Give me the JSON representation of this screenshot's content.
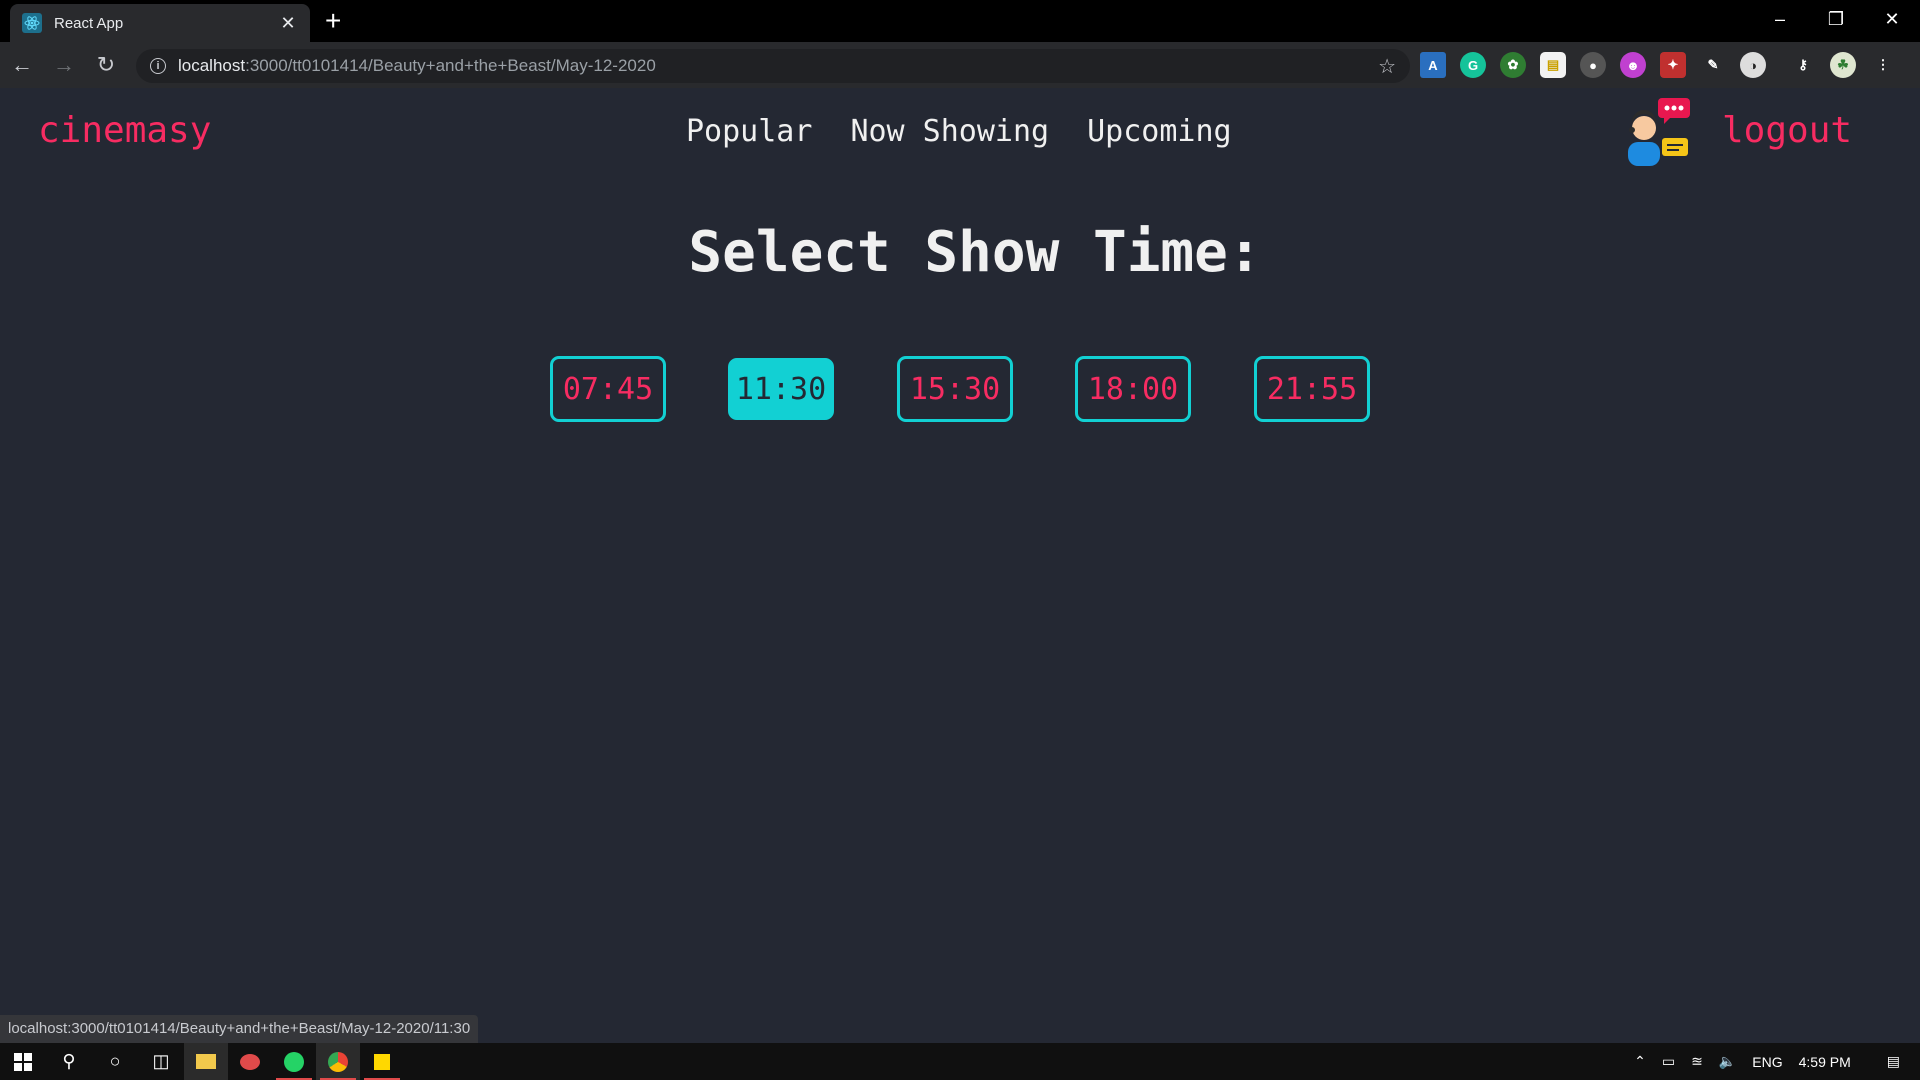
{
  "browser": {
    "tab_title": "React App",
    "url_host": "localhost",
    "url_rest": ":3000/tt0101414/Beauty+and+the+Beast/May-12-2020",
    "status_url": "localhost:3000/tt0101414/Beauty+and+the+Beast/May-12-2020/11:30"
  },
  "app": {
    "brand": "cinemasy",
    "nav": [
      "Popular",
      "Now Showing",
      "Upcoming"
    ],
    "logout": "logout",
    "heading": "Select Show Time:",
    "times": [
      {
        "label": "07:45",
        "active": false
      },
      {
        "label": "11:30",
        "active": true
      },
      {
        "label": "15:30",
        "active": false
      },
      {
        "label": "18:00",
        "active": false
      },
      {
        "label": "21:55",
        "active": false
      }
    ]
  },
  "taskbar": {
    "language": "ENG",
    "clock": "4:59 PM"
  },
  "colors": {
    "accent_pink": "#f72c62",
    "accent_cyan": "#12d0d3",
    "background": "#242833"
  }
}
